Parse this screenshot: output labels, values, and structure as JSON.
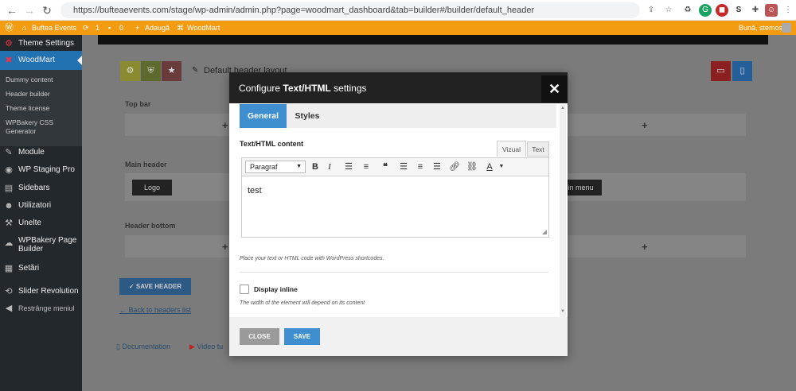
{
  "browser": {
    "url": "https://bufteaevents.com/stage/wp-admin/admin.php?page=woodmart_dashboard&tab=builder#/builder/default_header",
    "back_icon": "arrow-left-icon",
    "forward_icon": "arrow-right-icon",
    "reload_icon": "reload-icon"
  },
  "admin_bar": {
    "site_name": "Buftea Events",
    "updates_count": "1",
    "comments_count": "0",
    "new_label": "Adaugă",
    "woodmart_label": "WoodMart",
    "greeting": "Bună, stemos"
  },
  "sidebar": {
    "top_item": "Theme Settings",
    "active_item": "WoodMart",
    "subitems": [
      "Dummy content",
      "Header builder",
      "Theme license",
      "WPBakery CSS Generator"
    ],
    "items": [
      "Module",
      "WP Staging Pro",
      "Sidebars",
      "Utilizatori",
      "Unelte",
      "WPBakery Page Builder",
      "Setări",
      "Slider Revolution",
      "Restrânge meniul"
    ]
  },
  "builder": {
    "layout_title": "Default header layout",
    "top_bar_label": "Top bar",
    "main_header_label": "Main header",
    "header_bottom_label": "Header bottom",
    "logo_label": "Logo",
    "main_menu_label": "in menu",
    "save_header_label": "SAVE HEADER",
    "back_link": "← Back to headers list",
    "documentation_label": "Documentation",
    "video_label": "Video tu"
  },
  "modal": {
    "title_prefix": "Configure ",
    "title_bold": "Text/HTML",
    "title_suffix": " settings",
    "tabs": [
      "General",
      "Styles"
    ],
    "content_label": "Text/HTML content",
    "visual_tab": "Vizual",
    "text_tab": "Text",
    "format_select": "Paragraf",
    "editor_text": "test",
    "help_text": "Place your text or HTML code with WordPress shortcodes.",
    "display_inline_label": "Display inline",
    "display_inline_help": "The width of the element will depend on its content",
    "display_inline_checked": false,
    "close_label": "CLOSE",
    "save_label": "SAVE"
  },
  "colors": {
    "admin_bar": "#f39c12",
    "accent_blue": "#3e8ed0",
    "sidebar": "#23282d",
    "woodmart_active": "#2271b1"
  }
}
